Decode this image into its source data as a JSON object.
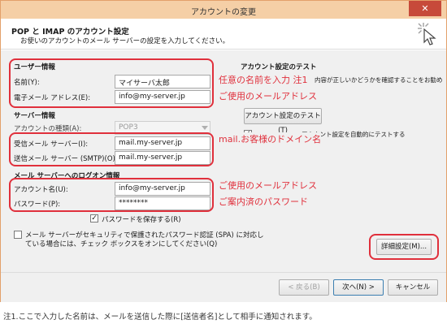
{
  "window": {
    "title": "アカウントの変更",
    "close_label": "✕"
  },
  "header": {
    "title": "POP と IMAP のアカウント設定",
    "subtitle": "お使いのアカウントのメール サーバーの設定を入力してください。"
  },
  "user_info": {
    "heading": "ユーザー情報",
    "name_label": "名前(Y):",
    "name_value": "マイサーバ太郎",
    "email_label": "電子メール アドレス(E):",
    "email_value": "info@my-server.jp"
  },
  "server_info": {
    "heading": "サーバー情報",
    "account_type_label": "アカウントの種類(A):",
    "account_type_value": "POP3",
    "incoming_label": "受信メール サーバー(I):",
    "incoming_value": "mail.my-server.jp",
    "outgoing_label": "送信メール サーバー (SMTP)(O):",
    "outgoing_value": "mail.my-server.jp"
  },
  "login_info": {
    "heading": "メール サーバーへのログオン情報",
    "account_label": "アカウント名(U):",
    "account_value": "info@my-server.jp",
    "password_label": "パスワード(P):",
    "password_value": "********",
    "save_password_label": "パスワードを保存する(R)",
    "spa_label_line1": "メール サーバーがセキュリティで保護されたパスワード認証 (SPA) に対応し",
    "spa_label_line2": "ている場合には、チェック ボックスをオンにしてください(Q)"
  },
  "test": {
    "heading": "アカウント設定のテスト",
    "desc": "内容が正しいかどうかを確認することをお勧め",
    "button_label": "アカウント設定のテスト(T)",
    "auto_test_label": "アカウント設定を自動的にテストする"
  },
  "annotations": {
    "name_note": "任意の名前を入力 注1",
    "email_note": "ご使用のメールアドレス",
    "server_note": "mail.お客様のドメイン名",
    "account_note": "ご使用のメールアドレス",
    "password_note": "ご案内済のパスワード"
  },
  "buttons": {
    "advanced": "詳細設定(M)...",
    "back": "< 戻る(B)",
    "next": "次へ(N) >",
    "cancel": "キャンセル"
  },
  "footnote": "注1.ここで入力した名前は、メールを送信した際に[送信者名]として相手に通知されます。",
  "colors": {
    "annotation_red": "#e0303c",
    "titlebar": "#f5cfa6"
  }
}
